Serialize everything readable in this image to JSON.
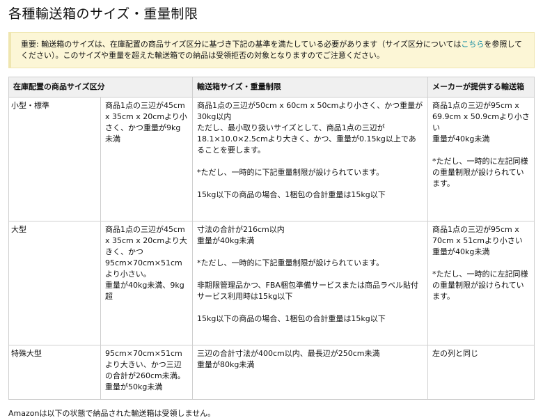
{
  "title": "各種輸送箱のサイズ・重量制限",
  "notice": {
    "before_link": "重要: 輸送箱のサイズは、在庫配置の商品サイズ区分に基づき下記の基準を満たしている必要があります（サイズ区分については",
    "link": "こちら",
    "after_link": "を参照してください）。このサイズや重量を超えた輸送箱での納品は受領拒否の対象となりますのでご注意ください。"
  },
  "table": {
    "headers": [
      "在庫配置の商品サイズ区分",
      "輸送箱サイズ・重量制限",
      "メーカーが提供する輸送箱"
    ],
    "rows": [
      {
        "category": "小型・標準",
        "product": [
          "商品1点の三辺が45cm x 35cm x 20cmより小さく、かつ重量が9kg未満"
        ],
        "box": [
          "商品1点の三辺が50cm x 60cm x 50cmより小さく、かつ重量が30kg以内",
          "ただし、最小取り扱いサイズとして、商品1点の三辺が18.1×10.0×2.5cmより大きく、かつ、重量が0.15kg以上であることを要します。",
          "",
          "*ただし、一時的に下記重量制限が設けられています。",
          "",
          "15kg以下の商品の場合、1梱包の合計重量は15kg以下"
        ],
        "maker": [
          "商品1点の三辺が95cm x 69.9cm x 50.9cmより小さい",
          "重量が40kg未満",
          "",
          "*ただし、一時的に左記同様の重量制限が設けられています。"
        ]
      },
      {
        "category": "大型",
        "product": [
          "商品1点の三辺が45cm x 35cm x 20cmより大きく、かつ95cm×70cm×51cmより小さい。",
          "重量が40kg未満、9kg超"
        ],
        "box": [
          "寸法の合計が216cm以内",
          "重量が40kg未満",
          "",
          "*ただし、一時的に下記重量制限が設けられています。",
          "",
          "非期限管理品かつ、FBA梱包準備サービスまたは商品ラベル貼付サービス利用時は15kg以下",
          "",
          "15kg以下の商品の場合、1梱包の合計重量は15kg以下"
        ],
        "maker": [
          "商品1点の三辺が95cm x 70cm x 51cmより小さい",
          "重量が40kg未満",
          "",
          "*ただし、一時的に左記同様の重量制限が設けられています。"
        ]
      },
      {
        "category": "特殊大型",
        "product": [
          "95cm×70cm×51cmより大きい、かつ三辺の合計が260cm未満。",
          "重量が50kg未満"
        ],
        "box": [
          "三辺の合計寸法が400cm以内、最長辺が250cm未満",
          "重量が80kg未満"
        ],
        "maker": [
          "左の列と同じ"
        ]
      }
    ]
  },
  "footer": "Amazonは以下の状態で納品された輸送箱は受領しません。"
}
